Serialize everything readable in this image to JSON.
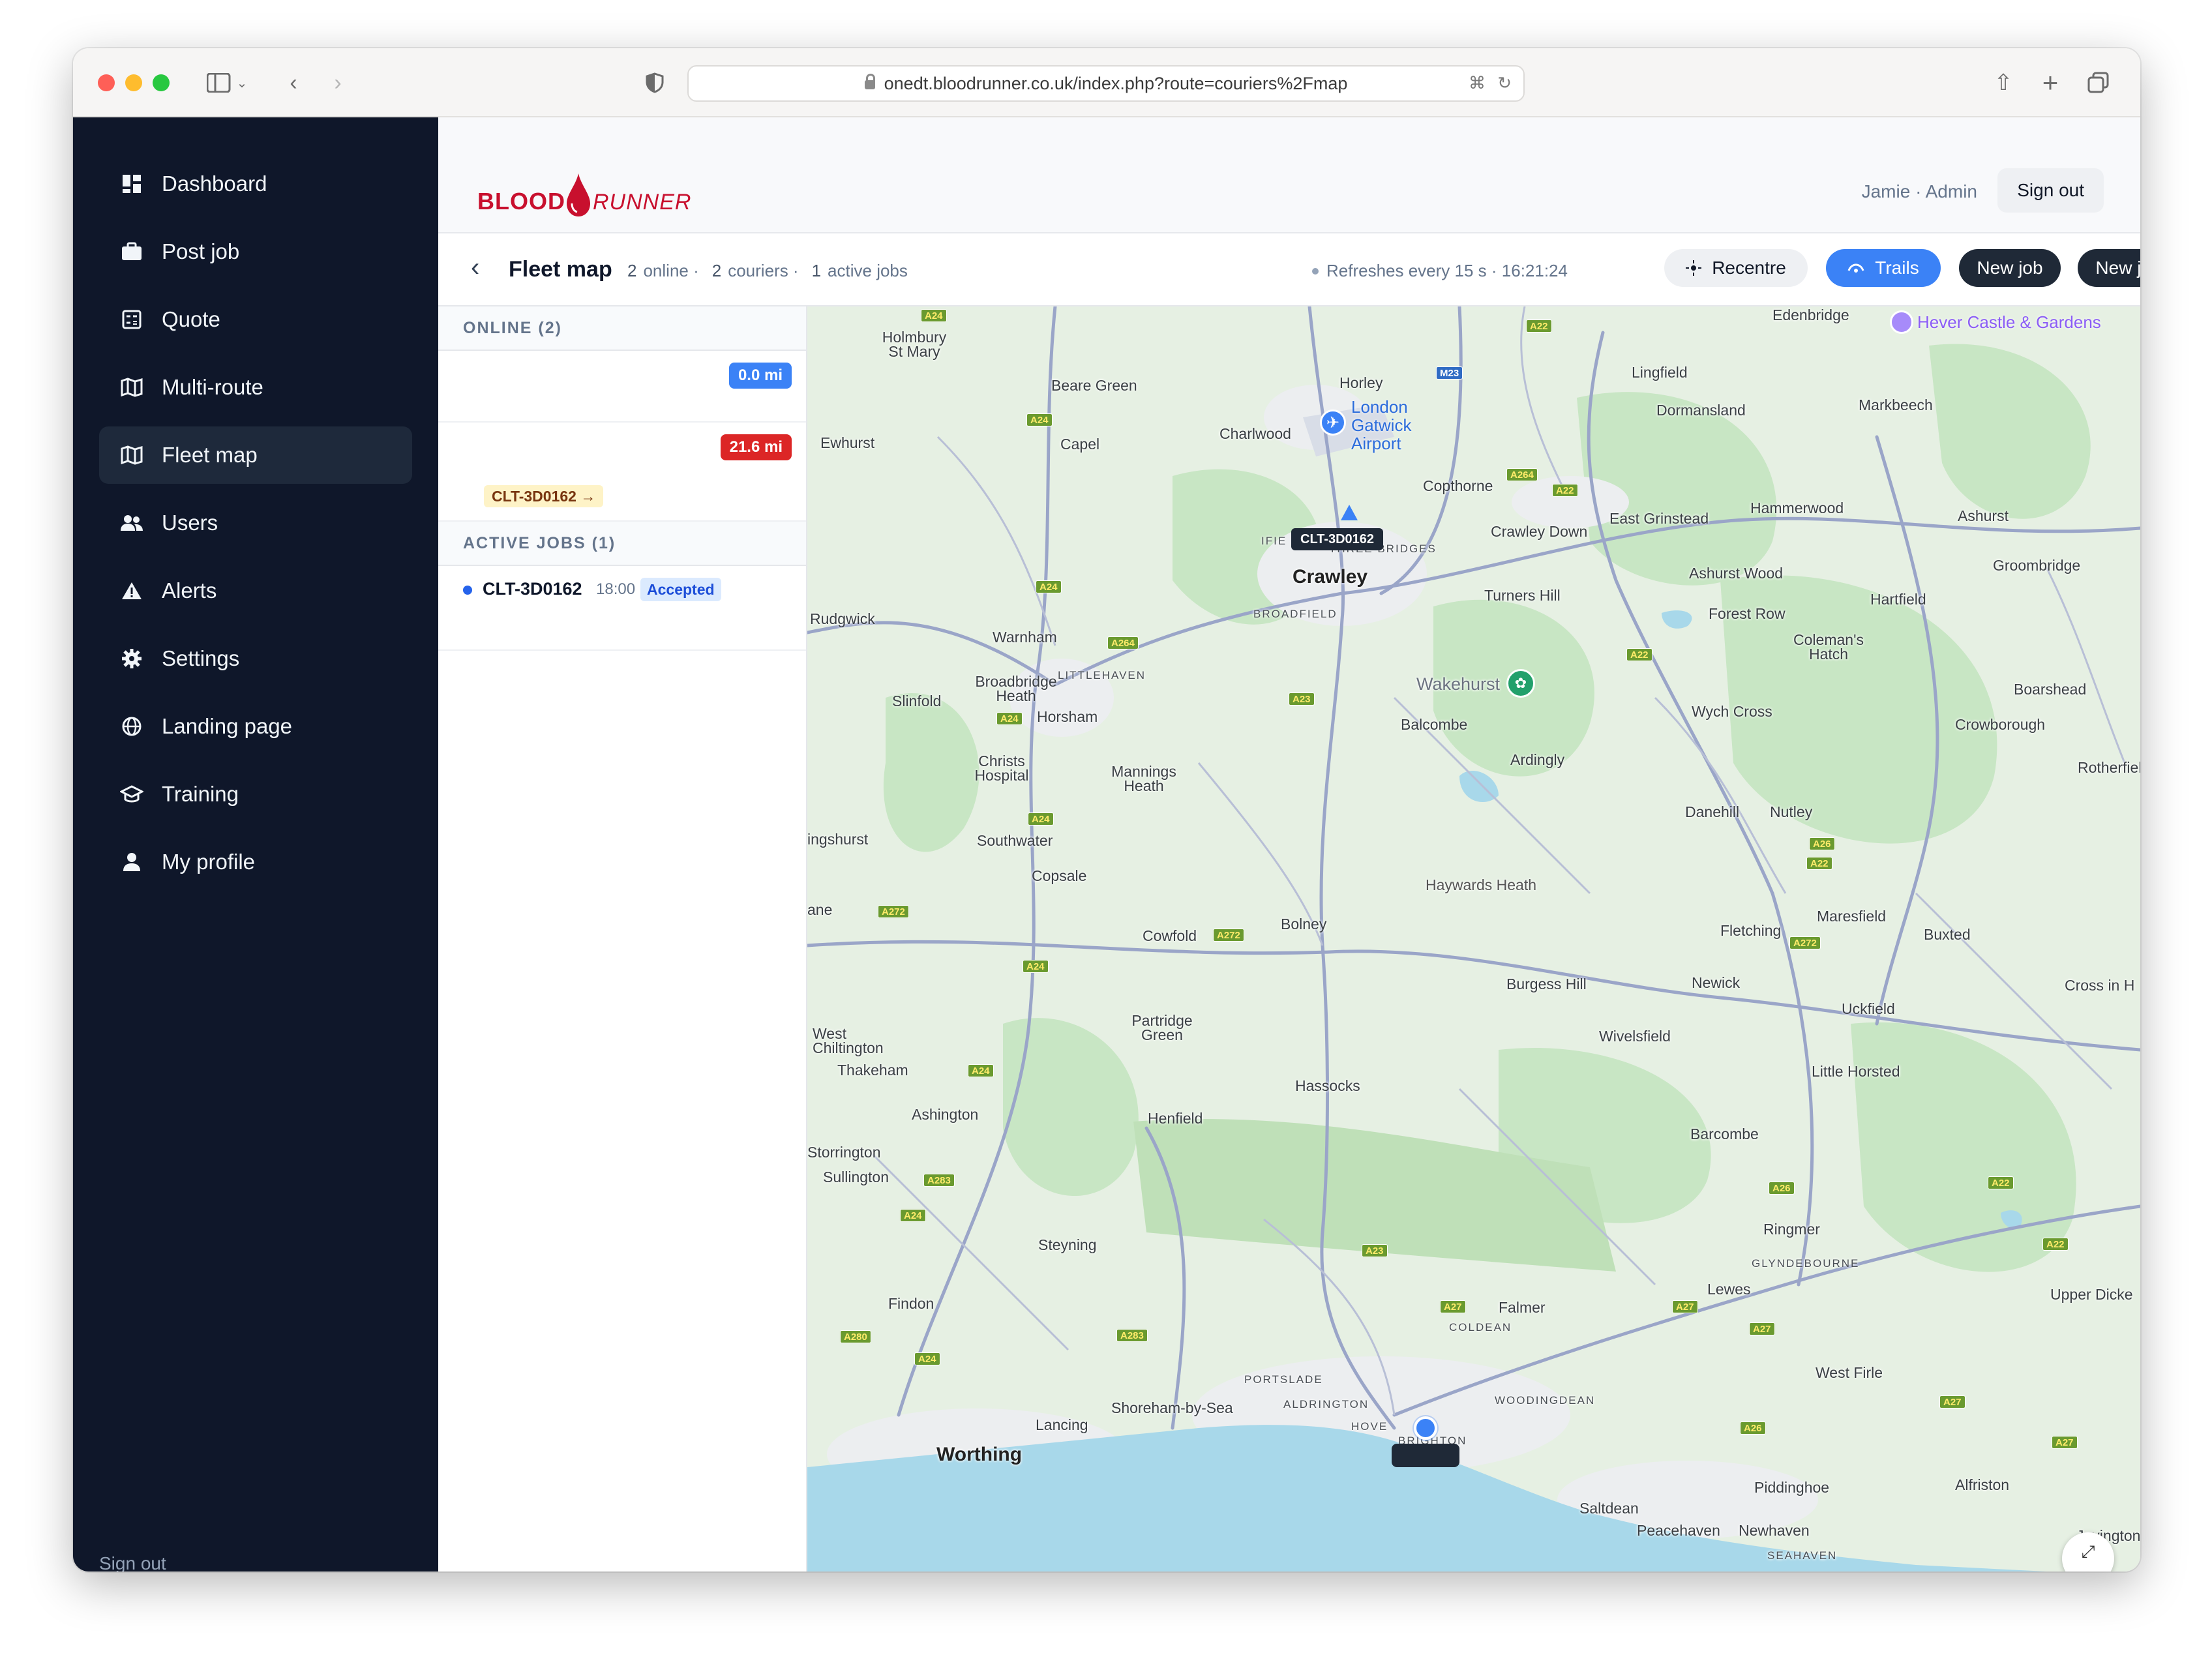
{
  "browser": {
    "url": "onedt.bloodrunner.co.uk/index.php?route=couriers%2Fmap"
  },
  "sidebar": {
    "items": [
      {
        "label": "Dashboard",
        "icon": "dashboard-icon"
      },
      {
        "label": "Post job",
        "icon": "briefcase-icon"
      },
      {
        "label": "Quote",
        "icon": "calculator-icon"
      },
      {
        "label": "Multi-route",
        "icon": "map-icon"
      },
      {
        "label": "Fleet map",
        "icon": "map-icon",
        "active": true
      },
      {
        "label": "Users",
        "icon": "users-icon"
      },
      {
        "label": "Alerts",
        "icon": "warning-icon"
      },
      {
        "label": "Settings",
        "icon": "gear-icon"
      },
      {
        "label": "Landing page",
        "icon": "globe-icon"
      },
      {
        "label": "Training",
        "icon": "graduation-cap-icon"
      },
      {
        "label": "My profile",
        "icon": "person-icon"
      }
    ],
    "sign_out": "Sign out"
  },
  "header": {
    "brand_blood": "BLOOD",
    "brand_runner": "RUNNER",
    "user": "Jamie · Admin",
    "sign_out": "Sign out"
  },
  "toolbar": {
    "title": "Fleet map",
    "online_count": "2",
    "online_label": "online ·",
    "couriers_count": "2",
    "couriers_label": "couriers ·",
    "jobs_count": "1",
    "jobs_label": "active jobs",
    "refresh": "Refreshes every 15 s · 16:21:24",
    "recentre": "Recentre",
    "trails": "Trails",
    "new_job": "New job",
    "new_job_2": "New job"
  },
  "panel": {
    "online_header": "ONLINE (2)",
    "couriers": [
      {
        "distance": "0.0 mi",
        "color": "#3b82f6"
      },
      {
        "distance": "21.6 mi",
        "color": "#dc2626",
        "job": "CLT-3D0162 →"
      }
    ],
    "jobs_header": "ACTIVE JOBS (1)",
    "jobs": [
      {
        "id": "CLT-3D0162",
        "time": "18:00",
        "status": "Accepted"
      }
    ]
  },
  "map": {
    "courier_label": "CLT-3D0162",
    "poi_hever": "Hever Castle & Gardens",
    "poi_gatwick": "London Gatwick Airport",
    "places": {
      "edenbridge": "Edenbridge",
      "holmbury": "Holmbury St Mary",
      "beare_green": "Beare Green",
      "horley": "Horley",
      "lingfield": "Lingfield",
      "markbeech": "Markbeech",
      "charlwood": "Charlwood",
      "dormansland": "Dormansland",
      "ewhurst": "Ewhurst",
      "capel": "Capel",
      "copthorne": "Copthorne",
      "hammerwood": "Hammerwood",
      "ashurst": "Ashurst",
      "crawley_down": "Crawley Down",
      "east_grinstead": "East Grinstead",
      "crawley": "Crawley",
      "three_bridges": "THREE BRIDGES",
      "ashurst_wood": "Ashurst Wood",
      "groombridge": "Groombridge",
      "broadfield": "BROADFIELD",
      "turners_hill": "Turners Hill",
      "forest_row": "Forest Row",
      "hartfield": "Hartfield",
      "rudgwick": "Rudgwick",
      "warnham": "Warnham",
      "colemans_hatch": "Coleman's Hatch",
      "littlehaven": "LITTLEHAVEN",
      "broadbridge_heath": "Broadbridge Heath",
      "horsham": "Horsham",
      "slinfold": "Slinfold",
      "wakehurst": "Wakehurst",
      "balcombe": "Balcombe",
      "wych_cross": "Wych Cross",
      "boarshead": "Boarshead",
      "crowborough": "Crowborough",
      "christs_hospital": "Christs Hospital",
      "mannings_heath": "Mannings Heath",
      "ardingly": "Ardingly",
      "rotherfield": "Rotherfiel",
      "danehill": "Danehill",
      "nutley": "Nutley",
      "ingsfurst": "ingshurst",
      "southwater": "Southwater",
      "copsale": "Copsale",
      "haywards": "Haywards Heath",
      "lane": "ane",
      "cowfold": "Cowfold",
      "bolney": "Bolney",
      "maresfield": "Maresfield",
      "fletching": "Fletching",
      "buxted": "Buxted",
      "burgess": "Burgess Hill",
      "newick": "Newick",
      "cross_in_hand": "Cross in H",
      "uckfield": "Uckfield",
      "west_chiltington": "West Chiltington",
      "partridge_green": "Partridge Green",
      "wivelsfield": "Wivelsfield",
      "thakeham": "Thakeham",
      "little_horsted": "Little Horsted",
      "hassocks": "Hassocks",
      "ashington": "Ashington",
      "henfield": "Henfield",
      "barcombe": "Barcombe",
      "storrington": "Storrington",
      "sullington": "Sullington",
      "ringmer": "Ringmer",
      "steyning": "Steyning",
      "glyndebourne": "GLYNDEBOURNE",
      "lewes": "Lewes",
      "upper_dicker": "Upper Dicke",
      "findon": "Findon",
      "falmer": "Falmer",
      "coldean": "COLDEAN",
      "west_firle": "West Firle",
      "portslade": "PORTSLADE",
      "woodingdean": "WOODINGDEAN",
      "shoreham": "Shoreham-by-Sea",
      "aldrington": "ALDRINGTON",
      "lancing": "Lancing",
      "hove": "HOVE",
      "brighton": "BRIGHTON",
      "worthing": "Worthing",
      "piddinghoe": "Piddinghoe",
      "alfriston": "Alfriston",
      "saltdean": "Saltdean",
      "peacehaven": "Peacehaven",
      "newhaven": "Newhaven",
      "jevington": "Jevington",
      "seahaven": "SEAHAVEN",
      "ifield": "IFIE"
    },
    "colors": {
      "land": "#e6f0e3",
      "forest": "#c8e6c4",
      "sea": "#a8d8ea",
      "road": "#9aa5c8",
      "urban": "#eceef0"
    }
  }
}
